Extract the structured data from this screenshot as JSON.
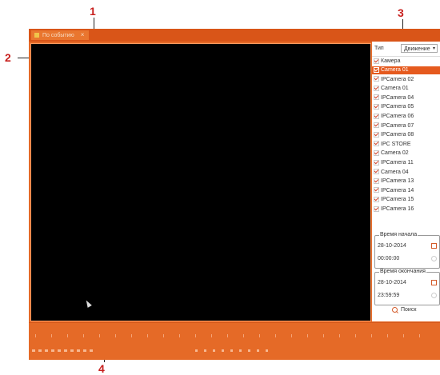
{
  "callouts": [
    "1",
    "2",
    "3",
    "4"
  ],
  "tab": {
    "label": "По событию",
    "close": "×"
  },
  "sidebar": {
    "type_label": "Тип",
    "type_value": "Движение",
    "camera_header": "Камера",
    "cameras": [
      "Camera 01",
      "IPCamera 02",
      "Camera 01",
      "IPCamera 04",
      "IPCamera 05",
      "IPCamera 06",
      "IPCamera 07",
      "IPCamera 08",
      "IPC STORE",
      "Camera 02",
      "IPCamera 11",
      "Camera 04",
      "IPCamera 13",
      "IPCamera 14",
      "IPCamera 15",
      "IPCamera 16"
    ],
    "selected_index": 0,
    "start": {
      "label": "Время начала",
      "date": "28-10-2014",
      "time": "00:00:00"
    },
    "end": {
      "label": "Время окончания",
      "date": "28-10-2014",
      "time": "23:59:59"
    },
    "search_label": "Поиск"
  },
  "colors": {
    "accent": "#e56a27",
    "title": "#d95518",
    "callout": "#c8201e",
    "video": "#000000"
  },
  "icons": {
    "tab": "camera-tab-icon",
    "calendar": "calendar-icon",
    "clock": "clock-icon",
    "search": "search-icon"
  }
}
